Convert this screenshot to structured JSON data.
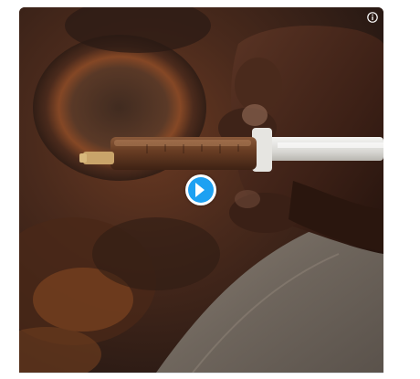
{
  "media": {
    "type": "video",
    "info_icon": "info-circle-icon",
    "play_icon": "play-icon",
    "accent_color": "#1da1f2",
    "frame_background": "#3a2318"
  }
}
